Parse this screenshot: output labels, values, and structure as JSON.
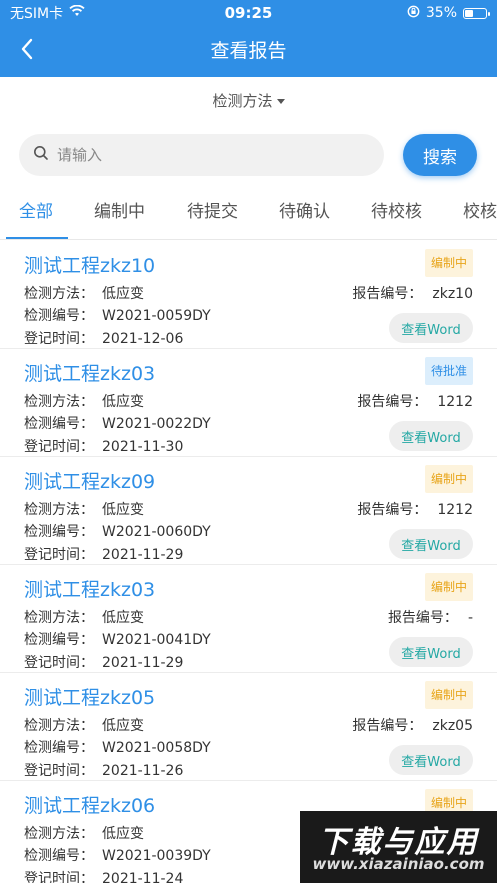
{
  "status_bar": {
    "carrier": "无SIM卡",
    "time": "09:25",
    "battery": "35%",
    "icons": [
      "wifi-icon",
      "orientation-lock-icon",
      "battery-icon"
    ]
  },
  "nav": {
    "title": "查看报告",
    "back_icon": "chevron-left-icon"
  },
  "filter": {
    "label": "检测方法"
  },
  "search": {
    "placeholder": "请输入",
    "value": "",
    "button_label": "搜索"
  },
  "tabs": [
    {
      "label": "全部",
      "active": true
    },
    {
      "label": "编制中",
      "active": false
    },
    {
      "label": "待提交",
      "active": false
    },
    {
      "label": "待确认",
      "active": false
    },
    {
      "label": "待校核",
      "active": false
    },
    {
      "label": "校核",
      "active": false
    }
  ],
  "labels": {
    "method": "检测方法：",
    "code": "检测编号：",
    "date": "登记时间：",
    "report": "报告编号：",
    "word_button": "查看Word"
  },
  "reports": [
    {
      "title": "测试工程zkz10",
      "status": "编制中",
      "status_type": "editing",
      "method": "低应变",
      "code": "W2021-0059DY",
      "date": "2021-12-06",
      "report_no": "zkz10",
      "show_word": true
    },
    {
      "title": "测试工程zkz03",
      "status": "待批准",
      "status_type": "approve",
      "method": "低应变",
      "code": "W2021-0022DY",
      "date": "2021-11-30",
      "report_no": "1212",
      "show_word": true
    },
    {
      "title": "测试工程zkz09",
      "status": "编制中",
      "status_type": "editing",
      "method": "低应变",
      "code": "W2021-0060DY",
      "date": "2021-11-29",
      "report_no": "1212",
      "show_word": true
    },
    {
      "title": "测试工程zkz03",
      "status": "编制中",
      "status_type": "editing",
      "method": "低应变",
      "code": "W2021-0041DY",
      "date": "2021-11-29",
      "report_no": "-",
      "show_word": true
    },
    {
      "title": "测试工程zkz05",
      "status": "编制中",
      "status_type": "editing",
      "method": "低应变",
      "code": "W2021-0058DY",
      "date": "2021-11-26",
      "report_no": "zkz05",
      "show_word": true
    },
    {
      "title": "测试工程zkz06",
      "status": "编制中",
      "status_type": "editing",
      "method": "低应变",
      "code": "W2021-0039DY",
      "date": "2021-11-24",
      "report_no": "",
      "show_word": false
    }
  ],
  "watermark": {
    "line1": "下载与应用",
    "line2": "www.xiazainiao.com"
  },
  "colors": {
    "primary": "#2f8fe6",
    "editing_badge_bg": "#fdf3dc",
    "editing_badge_text": "#e8a51b",
    "approve_badge_bg": "#dceefc",
    "word_button_text": "#24a8a4"
  }
}
